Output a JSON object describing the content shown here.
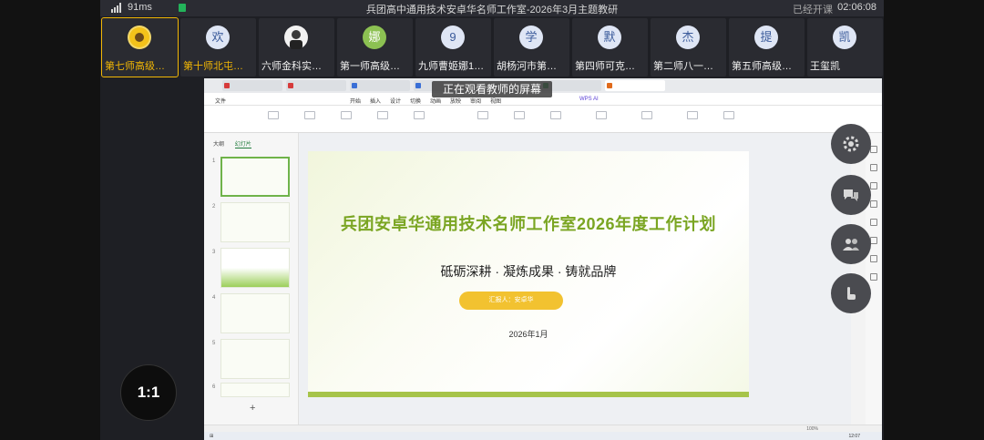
{
  "status": {
    "ping": "91ms",
    "meeting_title": "兵团高中通用技术安卓华名师工作室-2026年3月主题教研",
    "recording_label": "已经开课",
    "time": "02:06:08"
  },
  "participants": [
    {
      "name": "第七师高级…",
      "avatar": "sunflower",
      "highlight": true
    },
    {
      "name": "第十师北屯…",
      "avatar": "欢",
      "highlight": true
    },
    {
      "name": "六师金科实…",
      "avatar": "photo",
      "highlight": false
    },
    {
      "name": "第一师高级…",
      "avatar": "娜",
      "highlight": false
    },
    {
      "name": "九师曹姬娜1…",
      "avatar": "9",
      "highlight": false
    },
    {
      "name": "胡杨河市第…",
      "avatar": "学",
      "highlight": false
    },
    {
      "name": "第四师可克…",
      "avatar": "默",
      "highlight": false
    },
    {
      "name": "第二师八一…",
      "avatar": "杰",
      "highlight": false
    },
    {
      "name": "第五师高级…",
      "avatar": "提",
      "highlight": false
    },
    {
      "name": "王玺凯",
      "avatar": "凯",
      "highlight": false
    }
  ],
  "notice": "正在观看教师的屏幕",
  "shared_screen": {
    "panel_tabs": [
      "大纲",
      "幻灯片"
    ],
    "menu": [
      "文件",
      "开始",
      "插入",
      "设计",
      "切换",
      "动画",
      "放映",
      "审阅",
      "视图",
      "WPS AI"
    ],
    "slide": {
      "title": "兵团安卓华通用技术名师工作室2026年度工作计划",
      "subtitle": "砥砺深耕 · 凝炼成果 · 铸就品牌",
      "presenter": "汇报人：安卓华",
      "date": "2026年1月"
    },
    "zoom": "100%",
    "clock": "12:07"
  },
  "ratio_label": "1:1",
  "controls": [
    "gear-icon",
    "chat-icon",
    "people-icon",
    "hand-icon"
  ],
  "colors": {
    "accent_yellow": "#f2b705",
    "slide_green": "#7aa522",
    "pill": "#f2c230"
  }
}
